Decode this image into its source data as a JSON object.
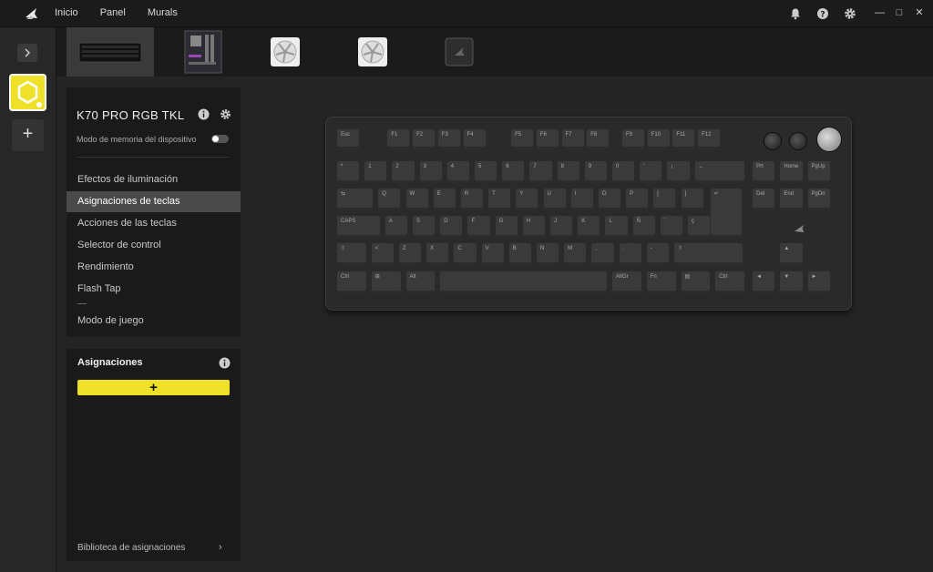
{
  "titlebar": {
    "nav": [
      "Inicio",
      "Panel",
      "Murals"
    ],
    "icons": [
      "bell-icon",
      "help-icon",
      "gear-icon"
    ]
  },
  "device_panel": {
    "title": "K70 PRO RGB TKL",
    "memory_label": "Modo de memoria del dispositivo",
    "memory_enabled": false
  },
  "menu": {
    "items": [
      "Efectos de iluminación",
      "Asignaciones de teclas",
      "Acciones de las teclas",
      "Selector de control",
      "Rendimiento",
      "Flash Tap",
      "Modo de juego"
    ],
    "active_index": 1
  },
  "assignments": {
    "title": "Asignaciones",
    "add_label": "+",
    "library_label": "Biblioteca de asignaciones"
  },
  "keyboard": {
    "rows": [
      [
        "Esc",
        "F1",
        "F2",
        "F3",
        "F4",
        "F5",
        "F6",
        "F7",
        "F8",
        "F9",
        "F10",
        "F11",
        "F12"
      ],
      [
        "º",
        "1",
        "2",
        "3",
        "4",
        "5",
        "6",
        "7",
        "8",
        "9",
        "0",
        "'",
        "¡",
        "←"
      ],
      [
        "⇆",
        "Q",
        "W",
        "E",
        "R",
        "T",
        "Y",
        "U",
        "I",
        "O",
        "P",
        "[",
        "]",
        "↵"
      ],
      [
        "CAPS",
        "A",
        "S",
        "D",
        "F",
        "G",
        "H",
        "J",
        "K",
        "L",
        "Ñ",
        "´",
        "ç"
      ],
      [
        "⇧",
        "<",
        "Z",
        "X",
        "C",
        "V",
        "B",
        "N",
        "M",
        ",",
        ".",
        "-",
        "⇧"
      ],
      [
        "Ctrl",
        "⊞",
        "Alt",
        "",
        "AltGr",
        "Fn",
        "▤",
        "Ctrl"
      ]
    ],
    "nav_cluster": [
      [
        "Prt",
        "Home",
        "PgUp"
      ],
      [
        "Del",
        "End",
        "PgDn"
      ]
    ],
    "arrows": [
      "▲",
      "◄",
      "▼",
      "►"
    ]
  }
}
